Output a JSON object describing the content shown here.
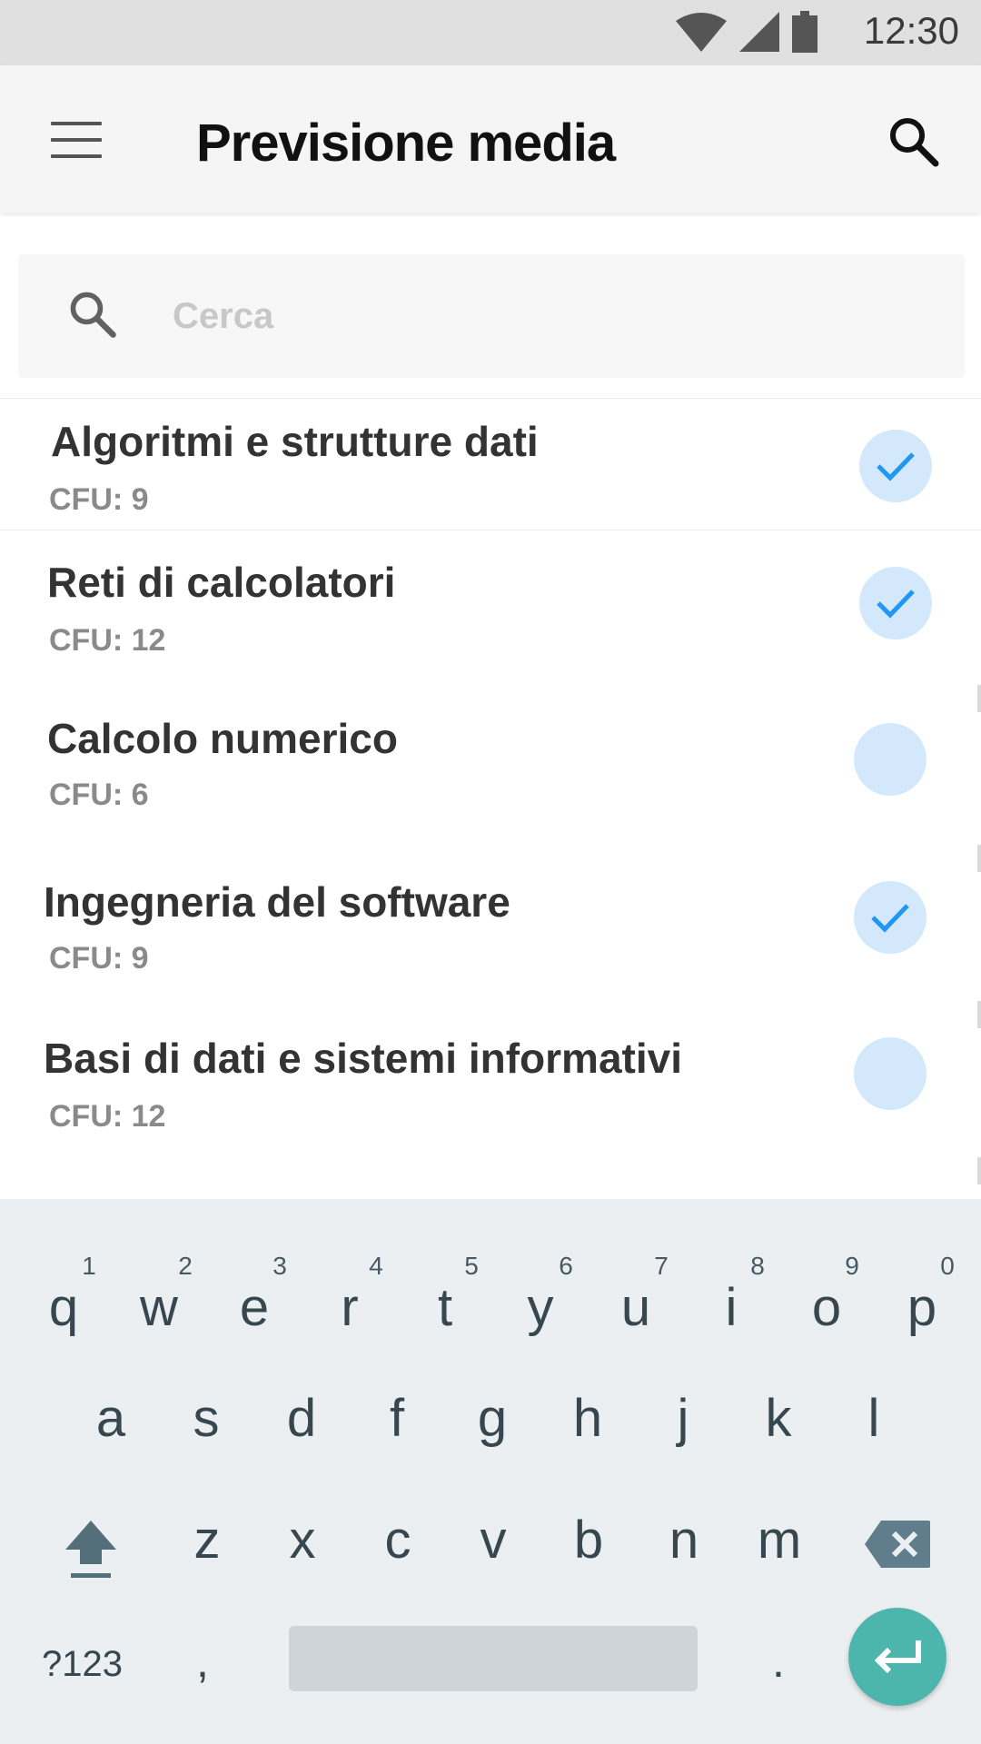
{
  "status_bar": {
    "time": "12:30"
  },
  "app_bar": {
    "title": "Previsione media"
  },
  "search": {
    "placeholder": "Cerca",
    "value": ""
  },
  "courses": [
    {
      "name": "Algoritmi e strutture dati",
      "cfu": "CFU: 9",
      "checked": true
    },
    {
      "name": "Reti di calcolatori",
      "cfu": "CFU: 12",
      "checked": true
    },
    {
      "name": "Calcolo numerico",
      "cfu": "CFU: 6",
      "checked": false
    },
    {
      "name": "Ingegneria del software",
      "cfu": "CFU: 9",
      "checked": true
    },
    {
      "name": "Basi di dati e sistemi informativi",
      "cfu": "CFU: 12",
      "checked": false
    }
  ],
  "keyboard": {
    "row1": [
      "q",
      "w",
      "e",
      "r",
      "t",
      "y",
      "u",
      "i",
      "o",
      "p"
    ],
    "row1_hints": [
      "1",
      "2",
      "3",
      "4",
      "5",
      "6",
      "7",
      "8",
      "9",
      "0"
    ],
    "row2": [
      "a",
      "s",
      "d",
      "f",
      "g",
      "h",
      "j",
      "k",
      "l"
    ],
    "row3": [
      "z",
      "x",
      "c",
      "v",
      "b",
      "n",
      "m"
    ],
    "symbols_label": "?123",
    "comma": ",",
    "period": "."
  },
  "colors": {
    "check_bg": "#d3e8fb",
    "check_mark": "#2196f3",
    "enter_key": "#4db6ac"
  }
}
